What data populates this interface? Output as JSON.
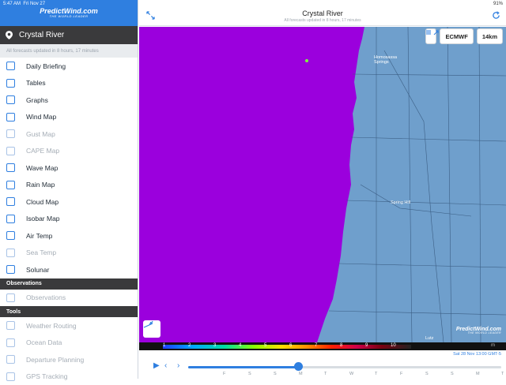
{
  "status": {
    "time": "5:47 AM",
    "date": "Fri Nov 27",
    "battery": "91%"
  },
  "app": {
    "logo": "PredictWind.com",
    "logo_tag": "THE WORLD LEADER"
  },
  "location": "Crystal River",
  "updated": "All forecasts updated in 8 hours, 17 minutes",
  "menu": [
    {
      "label": "Daily Briefing",
      "icon": "briefing-icon",
      "enabled": true
    },
    {
      "label": "Tables",
      "icon": "table-icon",
      "enabled": true
    },
    {
      "label": "Graphs",
      "icon": "graph-icon",
      "enabled": true
    },
    {
      "label": "Wind Map",
      "icon": "wind-icon",
      "enabled": true
    },
    {
      "label": "Gust Map",
      "icon": "gust-icon",
      "enabled": false
    },
    {
      "label": "CAPE Map",
      "icon": "cape-icon",
      "enabled": false
    },
    {
      "label": "Wave Map",
      "icon": "wave-icon",
      "enabled": true
    },
    {
      "label": "Rain Map",
      "icon": "rain-icon",
      "enabled": true
    },
    {
      "label": "Cloud Map",
      "icon": "cloud-icon",
      "enabled": true
    },
    {
      "label": "Isobar Map",
      "icon": "isobar-icon",
      "enabled": true
    },
    {
      "label": "Air Temp",
      "icon": "thermometer-icon",
      "enabled": true
    },
    {
      "label": "Sea Temp",
      "icon": "sea-thermometer-icon",
      "enabled": false
    },
    {
      "label": "Solunar",
      "icon": "moon-icon",
      "enabled": true
    }
  ],
  "sections": {
    "observations": "Observations",
    "tools": "Tools"
  },
  "observations": [
    {
      "label": "Observations",
      "icon": "flag-icon",
      "enabled": false
    }
  ],
  "tools": [
    {
      "label": "Weather Routing",
      "icon": "routing-icon",
      "enabled": false
    },
    {
      "label": "Ocean Data",
      "icon": "ocean-icon",
      "enabled": false
    },
    {
      "label": "Departure Planning",
      "icon": "departure-icon",
      "enabled": false
    },
    {
      "label": "GPS Tracking",
      "icon": "gps-icon",
      "enabled": false
    }
  ],
  "header": {
    "title": "Crystal River",
    "subtitle": "All forecasts updated in 8 hours, 17 minutes"
  },
  "map": {
    "model": "ECMWF",
    "resolution": "14km",
    "places": [
      "Homosassa Springs",
      "Spring Hill",
      "Lutz"
    ],
    "sea_color": "#9b00dd",
    "land_color": "#6f9fcc"
  },
  "legend": {
    "labels": [
      "1",
      "2",
      "3",
      "4",
      "5",
      "6",
      "7",
      "8",
      "9",
      "10"
    ],
    "unit": "m"
  },
  "timeline": {
    "timestamp": "Sat 28 Nov 13:00 GMT-5",
    "days": [
      "F",
      "S",
      "S",
      "M",
      "T",
      "W",
      "T",
      "F",
      "S",
      "S",
      "M",
      "T"
    ],
    "progress": 0.35
  }
}
